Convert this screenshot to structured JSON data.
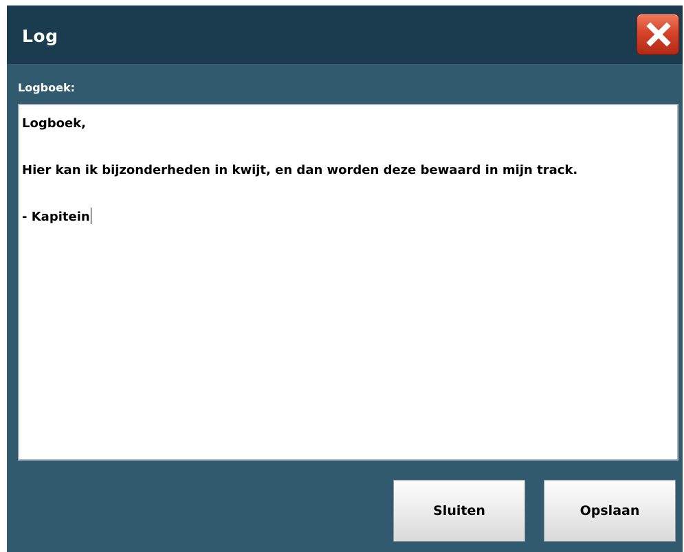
{
  "window": {
    "title": "Log",
    "close_icon": "close-icon"
  },
  "log": {
    "label": "Logboek:",
    "text": "Logboek,\n\nHier kan ik bijzonderheden in kwijt, en dan worden deze bewaard in mijn track.\n\n- Kapitein"
  },
  "buttons": {
    "close_label": "Sluiten",
    "save_label": "Opslaan"
  },
  "colors": {
    "background": "#325a6e",
    "titlebar": "#1b3b4e",
    "close_button": "#d7442a"
  }
}
